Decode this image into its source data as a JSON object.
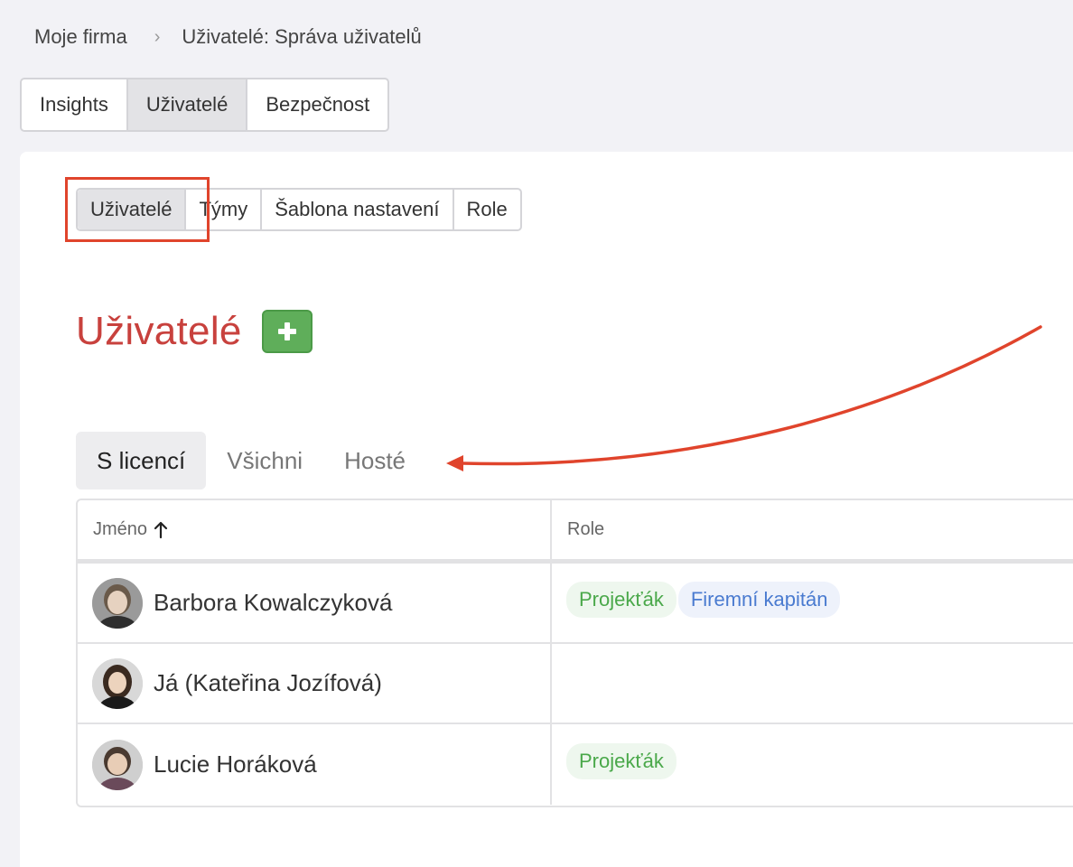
{
  "breadcrumb": {
    "root": "Moje firma",
    "current": "Uživatelé: Správa uživatelů"
  },
  "top_tabs": [
    {
      "label": "Insights",
      "active": false
    },
    {
      "label": "Uživatelé",
      "active": true
    },
    {
      "label": "Bezpečnost",
      "active": false
    }
  ],
  "sub_tabs": [
    {
      "label": "Uživatelé",
      "active": true
    },
    {
      "label": "Týmy",
      "active": false
    },
    {
      "label": "Šablona nastavení",
      "active": false
    },
    {
      "label": "Role",
      "active": false
    }
  ],
  "page": {
    "title": "Uživatelé",
    "add_icon": "plus-icon"
  },
  "filter_tabs": [
    {
      "label": "S licencí",
      "active": true
    },
    {
      "label": "Všichni",
      "active": false
    },
    {
      "label": "Hosté",
      "active": false
    }
  ],
  "table": {
    "columns": [
      "Jméno",
      "Role"
    ],
    "sort_icon": "arrow-up-icon",
    "rows": [
      {
        "name": "Barbora Kowalczyková",
        "roles": [
          {
            "label": "Projekťák",
            "color": "green"
          },
          {
            "label": "Firemní kapitán",
            "color": "blue"
          }
        ]
      },
      {
        "name": "Já (Kateřina Jozífová)",
        "roles": []
      },
      {
        "name": "Lucie Horáková",
        "roles": [
          {
            "label": "Projekťák",
            "color": "green"
          }
        ]
      }
    ]
  },
  "colors": {
    "title_red": "#c8413d",
    "add_green": "#5fae5a",
    "annotation_red": "#e0442c"
  }
}
